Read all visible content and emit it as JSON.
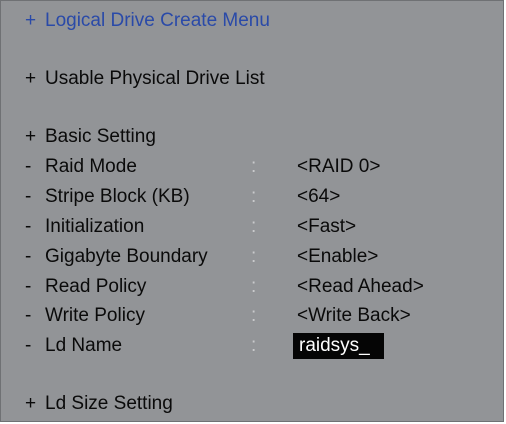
{
  "menu": {
    "title": "Logical Drive Create Menu",
    "sections": {
      "usable_drives": "Usable Physical Drive List",
      "basic_setting": "Basic Setting",
      "size_setting": "Ld Size Setting"
    },
    "markers": {
      "section": "+",
      "item": "-",
      "separator": ":"
    },
    "settings": {
      "raid_mode": {
        "label": "Raid Mode",
        "value": "<RAID 0>"
      },
      "stripe_block": {
        "label": "Stripe Block (KB)",
        "value": "<64>"
      },
      "initialization": {
        "label": "Initialization",
        "value": "<Fast>"
      },
      "gigabyte_boundary": {
        "label": "Gigabyte Boundary",
        "value": "<Enable>"
      },
      "read_policy": {
        "label": "Read Policy",
        "value": "<Read Ahead>"
      },
      "write_policy": {
        "label": "Write Policy",
        "value": "<Write Back>"
      },
      "ld_name": {
        "label": "Ld Name",
        "value": "raidsys_"
      }
    },
    "colors": {
      "background": "#929497",
      "title_text": "#2a4aa8",
      "selected_field_bg": "#050505",
      "selected_field_text": "#ffffff",
      "separator_text": "#c9cacc"
    }
  }
}
